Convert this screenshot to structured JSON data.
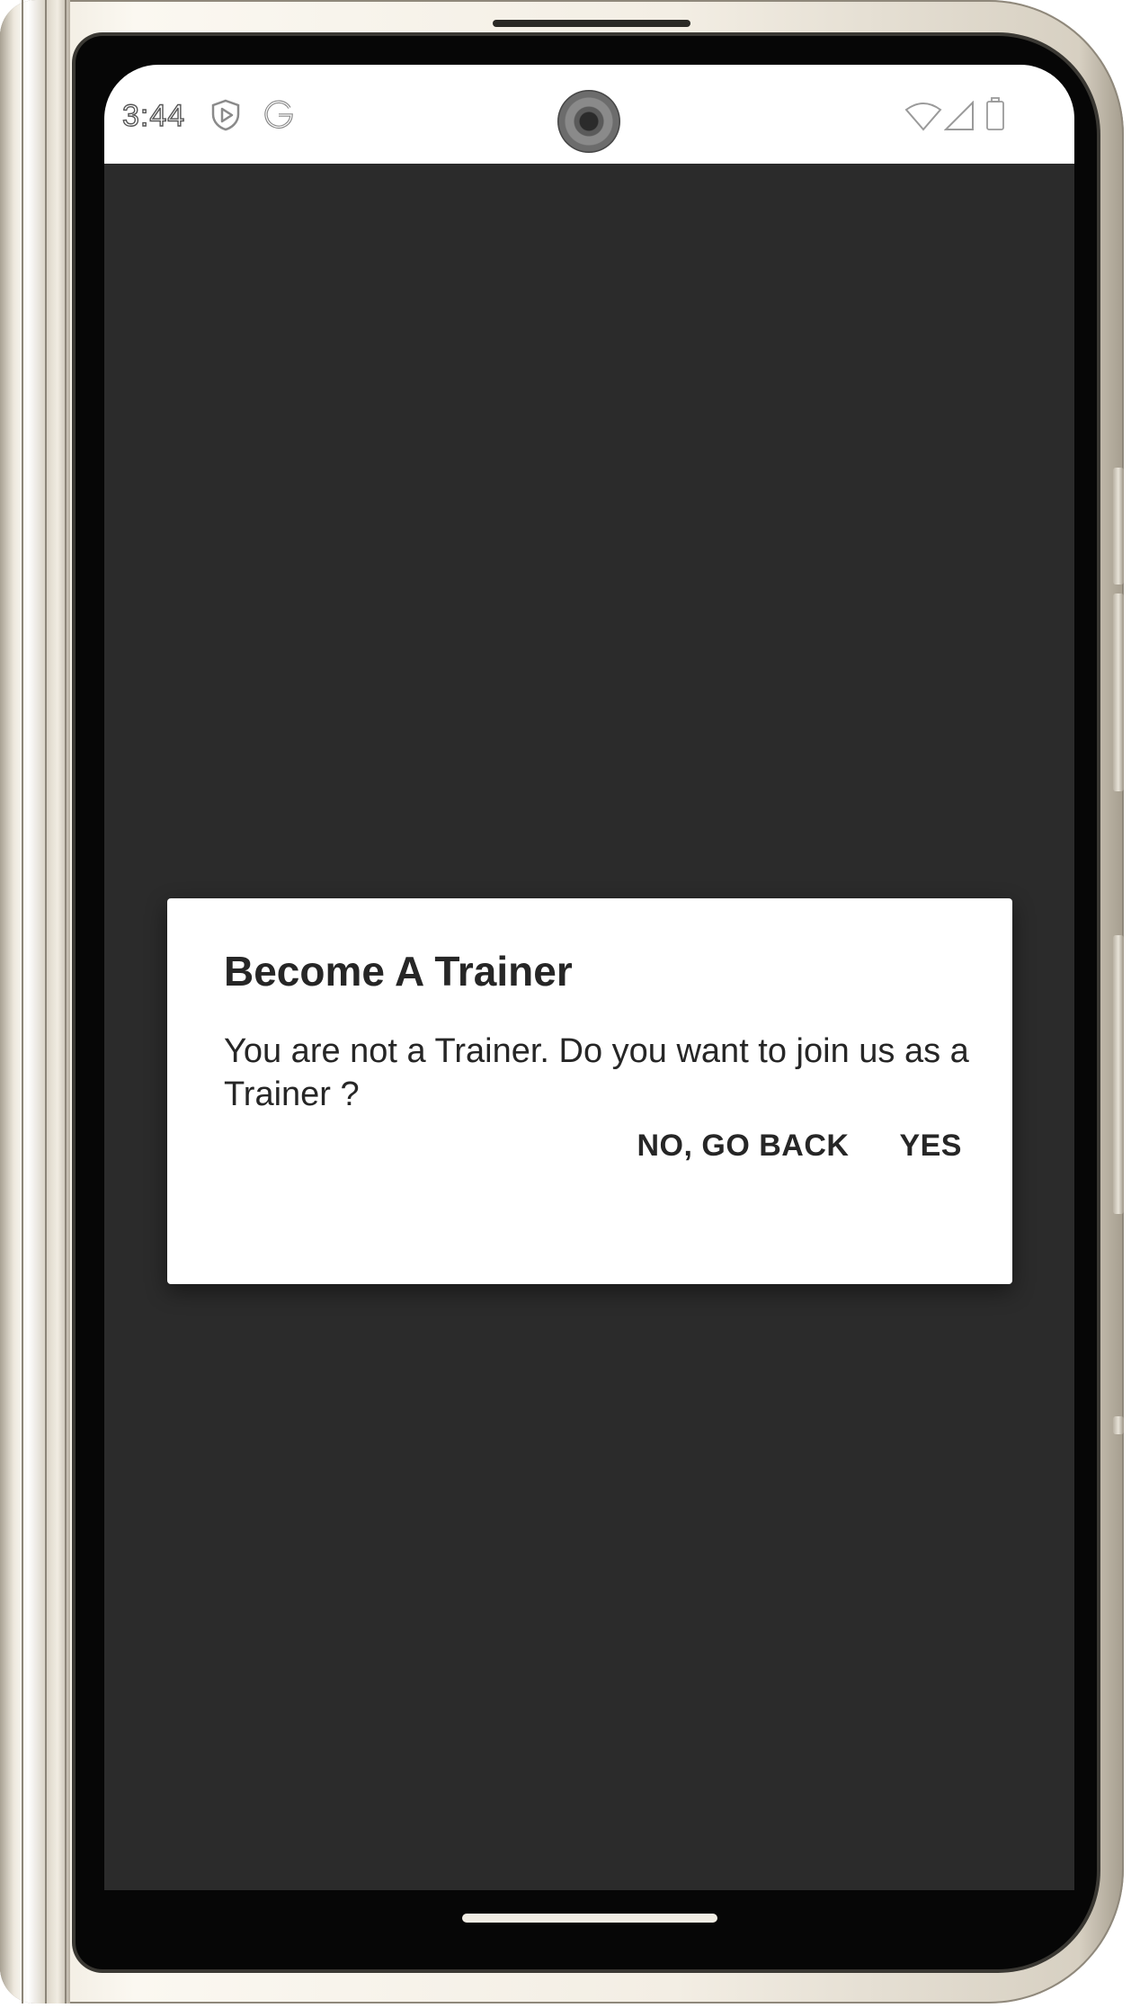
{
  "status_bar": {
    "time": "3:44",
    "left_icons": [
      "shield-play-icon",
      "google-icon"
    ],
    "right_icons": [
      "wifi-icon",
      "cell-signal-icon",
      "battery-icon"
    ]
  },
  "dialog": {
    "title": "Become A Trainer",
    "message": "You are not a Trainer. Do you want to join us as a Trainer ?",
    "negative_label": "NO, GO BACK",
    "positive_label": "YES"
  },
  "colors": {
    "app_background": "#2b2b2b",
    "dialog_background": "#ffffff",
    "text": "#262626"
  }
}
